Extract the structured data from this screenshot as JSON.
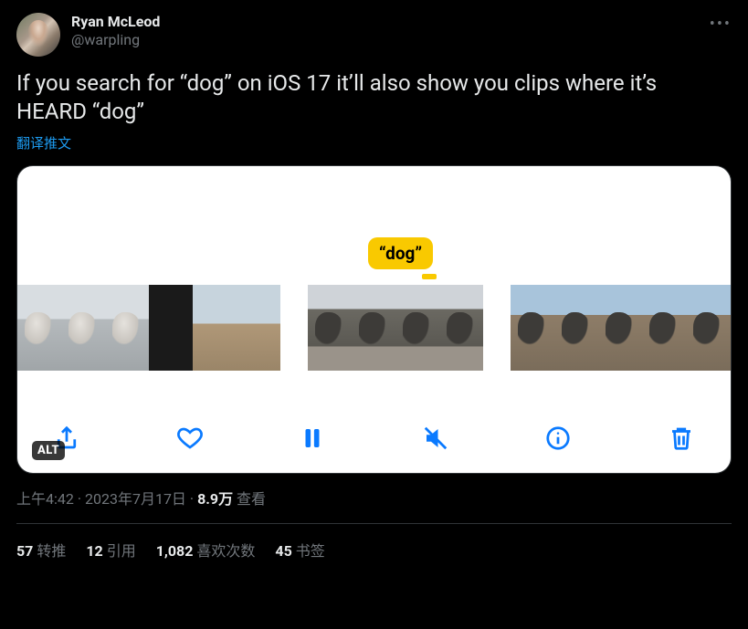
{
  "author": {
    "display_name": "Ryan McLeod",
    "handle": "@warpling"
  },
  "body": "If you search for “dog” on iOS 17 it’ll also show you clips where it’s HEARD “dog”",
  "translate_label": "翻译推文",
  "media": {
    "bubble_text": "“dog”",
    "alt_badge": "ALT",
    "toolbar": {
      "share": "share",
      "like": "like",
      "pause": "pause",
      "mute": "mute",
      "info": "info",
      "trash": "trash"
    }
  },
  "meta": {
    "time": "上午4:42",
    "sep1": " · ",
    "date": "2023年7月17日",
    "sep2": " · ",
    "views_num": "8.9万",
    "views_label": " 查看"
  },
  "stats": {
    "retweets_n": "57",
    "retweets_l": "转推",
    "quotes_n": "12",
    "quotes_l": "引用",
    "likes_n": "1,082",
    "likes_l": "喜欢次数",
    "bookmarks_n": "45",
    "bookmarks_l": "书签"
  }
}
